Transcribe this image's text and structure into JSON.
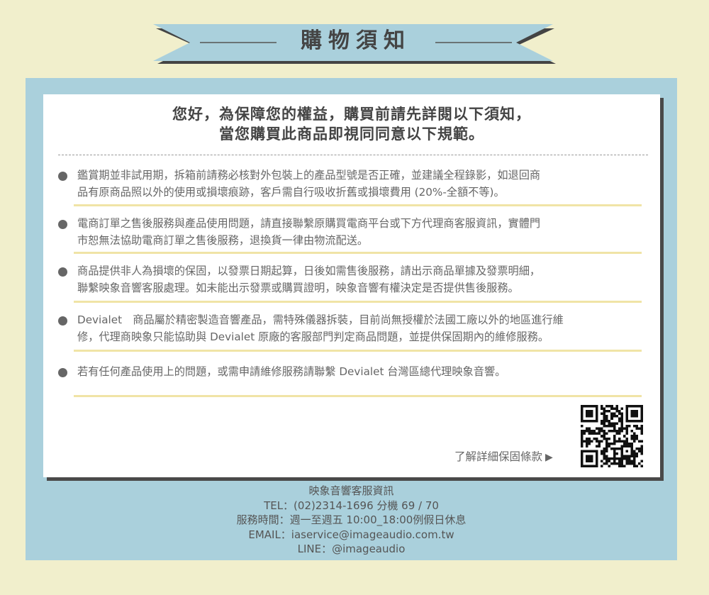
{
  "banner": {
    "title": "購物須知"
  },
  "intro": {
    "line1": "您好，為保障您的權益，購買前請先詳閱以下須知，",
    "line2": "當您購買此商品即視同同意以下規範。"
  },
  "items": [
    {
      "line1": "鑑賞期並非試用期，拆箱前請務必核對外包裝上的產品型號是否正確，並建議全程錄影，如退回商",
      "line2": "品有原商品照以外的使用或損壞痕跡，客戶需自行吸收折舊或損壞費用 (20%-全額不等)。"
    },
    {
      "line1": "電商訂單之售後服務與產品使用問題，請直接聯繫原購買電商平台或下方代理商客服資訊，實體門",
      "line2": "市恕無法協助電商訂單之售後服務，退換貨一律由物流配送。"
    },
    {
      "line1": "商品提供非人為損壞的保固，以發票日期起算，日後如需售後服務，請出示商品單據及發票明細，",
      "line2": "聯繫映象音響客服處理。如未能出示發票或購買證明，映象音響有權決定是否提供售後服務。"
    },
    {
      "line1": "Devialet　商品屬於精密製造音響產品，需特殊儀器拆裝，目前尚無授權於法國工廠以外的地區進行維",
      "line2": "修，代理商映象只能協助與 Devialet 原廠的客服部門判定商品問題，並提供保固期內的維修服務。"
    },
    {
      "line1": "若有任何產品使用上的問題，或需申請維修服務請聯繫 Devialet 台灣區總代理映象音響。",
      "line2": ""
    }
  ],
  "more_link": {
    "label": "了解詳細保固條款",
    "arrow": "▶"
  },
  "contact": {
    "title": "映象音響客服資訊",
    "tel": "TEL：(02)2314-1696 分機 69 / 70",
    "hours": "服務時間：週一至週五 10:00_18:00例假日休息",
    "email": "EMAIL：iaservice@imageaudio.com.tw",
    "line": "LINE：@imageaudio"
  },
  "colors": {
    "background": "#f1efcc",
    "panel": "#aad0dc",
    "card": "#ffffff",
    "divider": "#f0e4a6",
    "text": "#666666"
  },
  "icons": {
    "bullet": "filled-circle",
    "qr": "qr-code",
    "arrow": "play-triangle"
  }
}
